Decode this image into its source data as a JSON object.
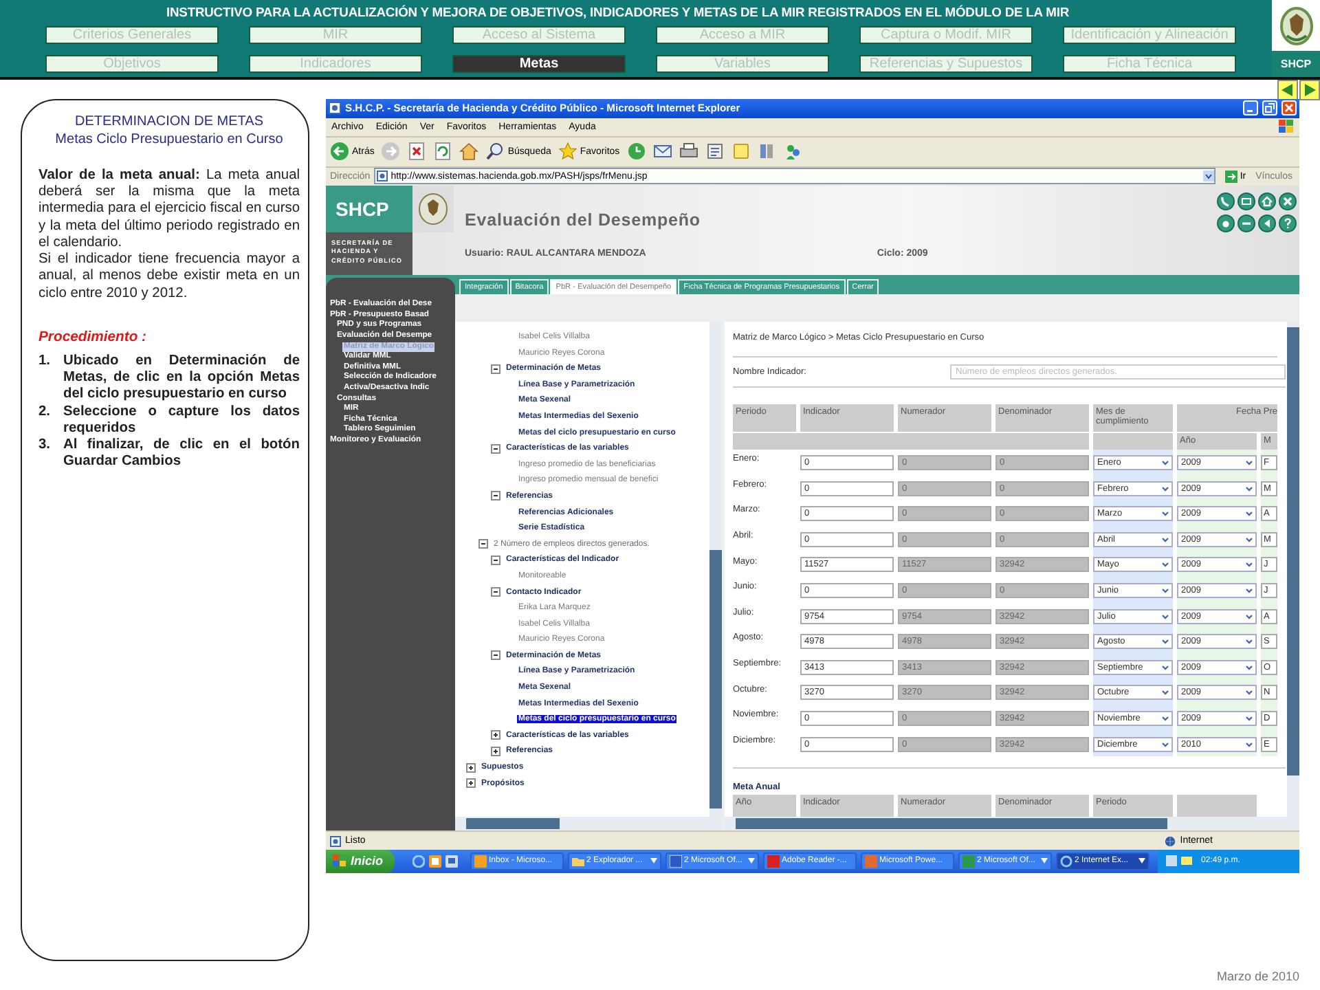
{
  "header": {
    "title": "INSTRUCTIVO PARA  LA ACTUALIZACIÓN Y MEJORA DE OBJETIVOS, INDICADORES Y METAS DE LA MIR REGISTRADOS EN EL MÓDULO DE LA MIR",
    "logo_text": "SHCP",
    "nav_rows": [
      [
        {
          "label": "Criterios Generales",
          "selected": false
        },
        {
          "label": "MIR",
          "selected": false
        },
        {
          "label": "Acceso al Sistema",
          "selected": false
        },
        {
          "label": "Acceso a MIR",
          "selected": false
        },
        {
          "label": "Captura o Modif. MIR",
          "selected": false
        },
        {
          "label": "Identificación y Alineación",
          "selected": false
        }
      ],
      [
        {
          "label": "Objetivos",
          "selected": false
        },
        {
          "label": "Indicadores",
          "selected": false
        },
        {
          "label": "Metas",
          "selected": true
        },
        {
          "label": "Variables",
          "selected": false
        },
        {
          "label": "Referencias y Supuestos",
          "selected": false
        },
        {
          "label": "Ficha Técnica",
          "selected": false
        }
      ]
    ]
  },
  "guide": {
    "heading": "DETERMINACION DE METAS",
    "subheading": "Metas Ciclo Presupuestario en Curso",
    "paragraphs": [
      "**Valor de la meta anual:**  La meta anual deberá ser la misma que la meta intermedia para el ejercicio fiscal en curso y la meta del último periodo registrado en el calendario.",
      "Si el indicador tiene frecuencia mayor a anual, al menos debe existir meta en un ciclo entre 2010 y 2012."
    ],
    "procedure_title": "Procedimiento :",
    "steps": [
      {
        "number": "1.",
        "text": "Ubicado en Determinación de Metas, de clic en la opción Metas del ciclo presupuestario en curso"
      },
      {
        "number": "2.",
        "text": "Seleccione o capture los datos requeridos"
      },
      {
        "number": "3.",
        "text": "Al finalizar, de clic en el botón Guardar Cambios"
      }
    ]
  },
  "browser": {
    "title": "S.H.C.P. - Secretaría de Hacienda y Crédito Público - Microsoft Internet Explorer",
    "menu": [
      "Archivo",
      "Edición",
      "Ver",
      "Favoritos",
      "Herramientas",
      "Ayuda"
    ],
    "toolbar": [
      {
        "kind": "back",
        "label": "Atrás"
      },
      {
        "kind": "forward"
      },
      {
        "kind": "stop"
      },
      {
        "kind": "refresh"
      },
      {
        "kind": "home"
      },
      {
        "kind": "search",
        "label": "Búsqueda"
      },
      {
        "kind": "favorites",
        "label": "Favoritos"
      },
      {
        "kind": "history"
      },
      {
        "kind": "mail"
      },
      {
        "kind": "print"
      },
      {
        "kind": "edit"
      },
      {
        "kind": "note"
      },
      {
        "kind": "research"
      },
      {
        "kind": "messenger"
      }
    ],
    "address": {
      "label": "Dirección",
      "url": "http://www.sistemas.hacienda.gob.mx/PASH/jsps/frMenu.jsp",
      "go": "Ir",
      "links": "Vínculos"
    },
    "site": {
      "logo": "SHCP",
      "agency": "SECRETARÍA DE HACIENDA Y CRÉDITO PÚBLICO",
      "app_title": "Evaluación del Desempeño",
      "user": "Usuario: RAUL ALCANTARA MENDOZA",
      "cycle": "Ciclo: 2009",
      "tabs": [
        {
          "label": "Integración",
          "selected": false
        },
        {
          "label": "Bitacora",
          "selected": false
        },
        {
          "label": "PbR - Evaluación del Desempeño",
          "selected": true
        },
        {
          "label": "Ficha Técnica de Programas Presupuestarios",
          "selected": false
        },
        {
          "label": "Cerrar",
          "selected": false
        }
      ]
    },
    "nav": [
      {
        "label": "PbR - Evaluación del Dese",
        "selected": false
      },
      {
        "label": "PbR - Presupuesto Basad",
        "selected": false,
        "children": [
          {
            "label": "PND y sus Programas",
            "selected": false
          },
          {
            "label": "Evaluación del Desempe",
            "selected": false,
            "children": [
              {
                "label": "Matriz de Marco Lógico",
                "selected": true
              },
              {
                "label": "Validar MML",
                "selected": false
              },
              {
                "label": "Definitiva MML",
                "selected": false
              },
              {
                "label": "Selección de Indicadore",
                "selected": false
              },
              {
                "label": "Activa/Desactiva Indic",
                "selected": false
              }
            ]
          },
          {
            "label": "Consultas",
            "selected": false,
            "children": [
              {
                "label": "MIR",
                "selected": false
              },
              {
                "label": "Ficha Técnica",
                "selected": false
              },
              {
                "label": "Tablero Seguimien",
                "selected": false
              }
            ]
          }
        ]
      },
      {
        "label": "Monitoreo y Evaluación",
        "selected": false
      }
    ],
    "tree": [
      {
        "children": [
          {
            "children": [
              {
                "children": [
                  {
                    "label": "Isabel Celis Villalba",
                    "kind": "leaf",
                    "selected": false
                  },
                  {
                    "label": "Mauricio Reyes Corona",
                    "kind": "leaf",
                    "selected": false
                  }
                ]
              },
              {
                "label": "Determinación de Metas",
                "kind": "group",
                "expanded": true,
                "selected": false,
                "children": [
                  {
                    "label": "Línea Base y Parametrización",
                    "kind": "link",
                    "selected": false
                  },
                  {
                    "label": "Meta Sexenal",
                    "kind": "link",
                    "selected": false
                  },
                  {
                    "label": "Metas Intermedias del Sexenio",
                    "kind": "link",
                    "selected": false
                  },
                  {
                    "label": "Metas del ciclo presupuestario en curso",
                    "kind": "link",
                    "selected": false
                  }
                ]
              },
              {
                "label": "Características de las variables",
                "kind": "group",
                "expanded": true,
                "selected": false,
                "children": [
                  {
                    "label": "Ingreso promedio de las beneficiarias",
                    "kind": "leaf",
                    "selected": false
                  },
                  {
                    "label": "Ingreso promedio mensual de benefici",
                    "kind": "leaf",
                    "selected": false
                  }
                ]
              },
              {
                "label": "Referencias",
                "kind": "group",
                "expanded": true,
                "selected": false,
                "children": [
                  {
                    "label": "Referencias Adicionales",
                    "kind": "link",
                    "selected": false
                  },
                  {
                    "label": "Serie Estadística",
                    "kind": "link",
                    "selected": false
                  }
                ]
              }
            ]
          },
          {
            "label": "2 Número de empleos directos generados.",
            "kind": "indicator",
            "expanded": true,
            "selected": false,
            "children": [
              {
                "label": "Características del Indicador",
                "kind": "group",
                "expanded": true,
                "selected": false,
                "children": [
                  {
                    "label": "Monitoreable",
                    "kind": "leaf",
                    "selected": false
                  }
                ]
              },
              {
                "label": "Contacto Indicador",
                "kind": "group",
                "expanded": true,
                "selected": false,
                "children": [
                  {
                    "label": "Erika Lara Marquez",
                    "kind": "leaf",
                    "selected": false
                  },
                  {
                    "label": "Isabel Celis Villalba",
                    "kind": "leaf",
                    "selected": false
                  },
                  {
                    "label": "Mauricio Reyes Corona",
                    "kind": "leaf",
                    "selected": false
                  }
                ]
              },
              {
                "label": "Determinación de Metas",
                "kind": "group",
                "expanded": true,
                "selected": false,
                "children": [
                  {
                    "label": "Línea Base y Parametrización",
                    "kind": "link",
                    "selected": false
                  },
                  {
                    "label": "Meta Sexenal",
                    "kind": "link",
                    "selected": false
                  },
                  {
                    "label": "Metas Intermedias del Sexenio",
                    "kind": "link",
                    "selected": false
                  },
                  {
                    "label": "Metas del ciclo presupuestario en curso",
                    "kind": "link",
                    "selected": true
                  }
                ]
              },
              {
                "label": "Características de las variables",
                "kind": "group",
                "expanded": false,
                "selected": false
              },
              {
                "label": "Referencias",
                "kind": "group",
                "expanded": false,
                "selected": false
              }
            ]
          }
        ]
      },
      {
        "label": "Supuestos",
        "kind": "group",
        "expanded": false,
        "selected": false
      },
      {
        "label": "Propósitos",
        "kind": "group",
        "expanded": false,
        "selected": false
      }
    ],
    "form": {
      "breadcrumb": "Matriz de Marco Lógico > Metas Ciclo Presupuestario en Curso",
      "indicator_label": "Nombre Indicador:",
      "indicator_value": "Número de empleos directos generados.",
      "columns": [
        "Periodo",
        "Indicador",
        "Numerador",
        "Denominador",
        "Mes de cumplimiento",
        "Fecha Pre"
      ],
      "subcolumns": [
        "Año",
        "M"
      ],
      "rows": [
        {
          "period": "Enero:",
          "indicador": "0",
          "numerador": "0",
          "denominador": "0",
          "mes": "Enero",
          "anio": "2009",
          "column_7": "F"
        },
        {
          "period": "Febrero:",
          "indicador": "0",
          "numerador": "0",
          "denominador": "0",
          "mes": "Febrero",
          "anio": "2009",
          "column_7": "M"
        },
        {
          "period": "Marzo:",
          "indicador": "0",
          "numerador": "0",
          "denominador": "0",
          "mes": "Marzo",
          "anio": "2009",
          "column_7": "A"
        },
        {
          "period": "Abril:",
          "indicador": "0",
          "numerador": "0",
          "denominador": "0",
          "mes": "Abril",
          "anio": "2009",
          "column_7": "M"
        },
        {
          "period": "Mayo:",
          "indicador": "11527",
          "numerador": "11527",
          "denominador": "32942",
          "mes": "Mayo",
          "anio": "2009",
          "column_7": "J"
        },
        {
          "period": "Junio:",
          "indicador": "0",
          "numerador": "0",
          "denominador": "0",
          "mes": "Junio",
          "anio": "2009",
          "column_7": "J"
        },
        {
          "period": "Julio:",
          "indicador": "9754",
          "numerador": "9754",
          "denominador": "32942",
          "mes": "Julio",
          "anio": "2009",
          "column_7": "A"
        },
        {
          "period": "Agosto:",
          "indicador": "4978",
          "numerador": "4978",
          "denominador": "32942",
          "mes": "Agosto",
          "anio": "2009",
          "column_7": "S"
        },
        {
          "period": "Septiembre:",
          "indicador": "3413",
          "numerador": "3413",
          "denominador": "32942",
          "mes": "Septiembre",
          "anio": "2009",
          "column_7": "O"
        },
        {
          "period": "Octubre:",
          "indicador": "3270",
          "numerador": "3270",
          "denominador": "32942",
          "mes": "Octubre",
          "anio": "2009",
          "column_7": "N"
        },
        {
          "period": "Noviembre:",
          "indicador": "0",
          "numerador": "0",
          "denominador": "32942",
          "mes": "Noviembre",
          "anio": "2009",
          "column_7": "D"
        },
        {
          "period": "Diciembre:",
          "indicador": "0",
          "numerador": "0",
          "denominador": "32942",
          "mes": "Diciembre",
          "anio": "2010",
          "column_7": "E"
        }
      ],
      "annual_title": "Meta Anual",
      "annual_columns": [
        "Año",
        "Indicador",
        "Numerador",
        "Denominador",
        "Periodo"
      ]
    },
    "status": {
      "text": "Listo",
      "zone": "Internet"
    },
    "taskbar": {
      "start": "Inicio",
      "tasks": [
        {
          "kind": "mail",
          "label": "Inbox - Microso...",
          "grouped": false,
          "selected": false
        },
        {
          "kind": "folder",
          "label": "2 Explorador ...",
          "grouped": true,
          "selected": false
        },
        {
          "kind": "word",
          "label": "2 Microsoft Of...",
          "grouped": true,
          "selected": false
        },
        {
          "kind": "pdf",
          "label": "Adobe Reader -...",
          "grouped": false,
          "selected": false
        },
        {
          "kind": "slides",
          "label": "Microsoft Powe...",
          "grouped": false,
          "selected": false
        },
        {
          "kind": "sheet",
          "label": "2 Microsoft Of...",
          "grouped": true,
          "selected": false
        },
        {
          "kind": "browser",
          "label": "2 Internet Ex...",
          "grouped": true,
          "selected": true
        }
      ],
      "clock": "02:49 p.m."
    }
  },
  "footer": "Marzo de 2010"
}
